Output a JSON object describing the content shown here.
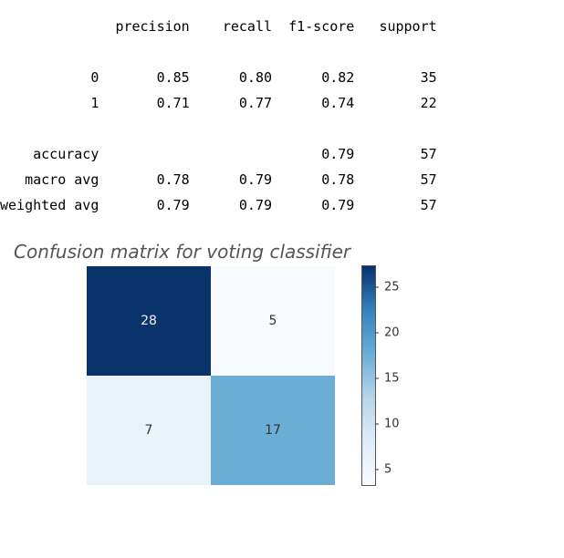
{
  "report": {
    "columns": [
      "precision",
      "recall",
      "f1-score",
      "support"
    ],
    "rows": [
      {
        "label": "0",
        "precision": "0.85",
        "recall": "0.80",
        "f1": "0.82",
        "support": "35"
      },
      {
        "label": "1",
        "precision": "0.71",
        "recall": "0.77",
        "f1": "0.74",
        "support": "22"
      }
    ],
    "accuracy": {
      "label": "accuracy",
      "f1": "0.79",
      "support": "57"
    },
    "macro": {
      "label": "macro avg",
      "precision": "0.78",
      "recall": "0.79",
      "f1": "0.78",
      "support": "57"
    },
    "weighted": {
      "label": "weighted avg",
      "precision": "0.79",
      "recall": "0.79",
      "f1": "0.79",
      "support": "57"
    }
  },
  "chart_title": "Confusion matrix for voting classifier",
  "chart_data": {
    "type": "heatmap",
    "title": "Confusion matrix for voting classifier",
    "xlabel": "",
    "ylabel": "",
    "matrix": [
      [
        28,
        5
      ],
      [
        7,
        17
      ]
    ],
    "vmin": 5,
    "vmax": 28,
    "colorbar_ticks": [
      5,
      10,
      15,
      20,
      25
    ],
    "cmap": "Blues",
    "cells": [
      {
        "value": 28,
        "color": "#0a326b",
        "text_color": "light"
      },
      {
        "value": 5,
        "color": "#f7fbff",
        "text_color": "dark"
      },
      {
        "value": 7,
        "color": "#eaf2fa",
        "text_color": "dark"
      },
      {
        "value": 17,
        "color": "#6aaed6",
        "text_color": "dark"
      }
    ]
  }
}
